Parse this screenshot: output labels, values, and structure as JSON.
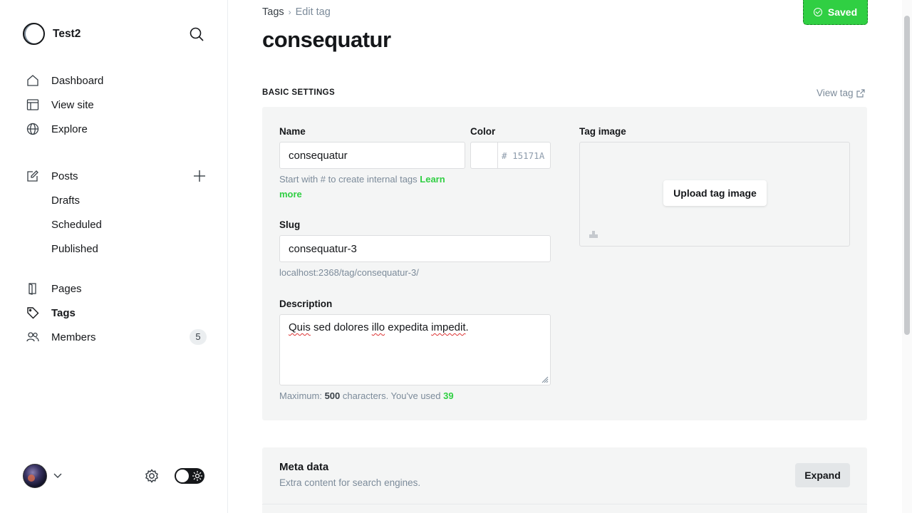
{
  "sidebar": {
    "site_name": "Test2",
    "nav": [
      {
        "label": "Dashboard",
        "icon": "home-icon"
      },
      {
        "label": "View site",
        "icon": "layout-icon"
      },
      {
        "label": "Explore",
        "icon": "globe-icon"
      }
    ],
    "posts": {
      "label": "Posts",
      "sub": [
        "Drafts",
        "Scheduled",
        "Published"
      ]
    },
    "nav2": [
      {
        "label": "Pages",
        "icon": "pages-icon"
      },
      {
        "label": "Tags",
        "icon": "tag-icon"
      },
      {
        "label": "Members",
        "icon": "members-icon",
        "badge": "5"
      }
    ]
  },
  "header": {
    "breadcrumb_parent": "Tags",
    "breadcrumb_current": "Edit tag",
    "title": "consequatur",
    "saved_label": "Saved"
  },
  "basic": {
    "section_title": "BASIC SETTINGS",
    "view_tag": "View tag",
    "name_label": "Name",
    "name_value": "consequatur",
    "name_hint": "Start with # to create internal tags ",
    "name_hint_link_1": "Learn",
    "name_hint_link_2": "more",
    "color_label": "Color",
    "color_hash": "#",
    "color_placeholder": "15171A",
    "slug_label": "Slug",
    "slug_value": "consequatur-3",
    "slug_url": "localhost:2368/tag/consequatur-3/",
    "desc_label": "Description",
    "desc_words": [
      "Quis",
      "sed dolores",
      "illo",
      "expedita",
      "impedit",
      "."
    ],
    "desc_hint_pre": "Maximum: ",
    "desc_max": "500",
    "desc_hint_mid": " characters. You've used ",
    "desc_used": "39",
    "image_label": "Tag image",
    "upload_label": "Upload tag image"
  },
  "meta": {
    "title": "Meta data",
    "subtitle": "Extra content for search engines.",
    "expand_label": "Expand"
  },
  "colors": {
    "accent_green": "#30cf43",
    "panel_bg": "#f4f5f5"
  }
}
